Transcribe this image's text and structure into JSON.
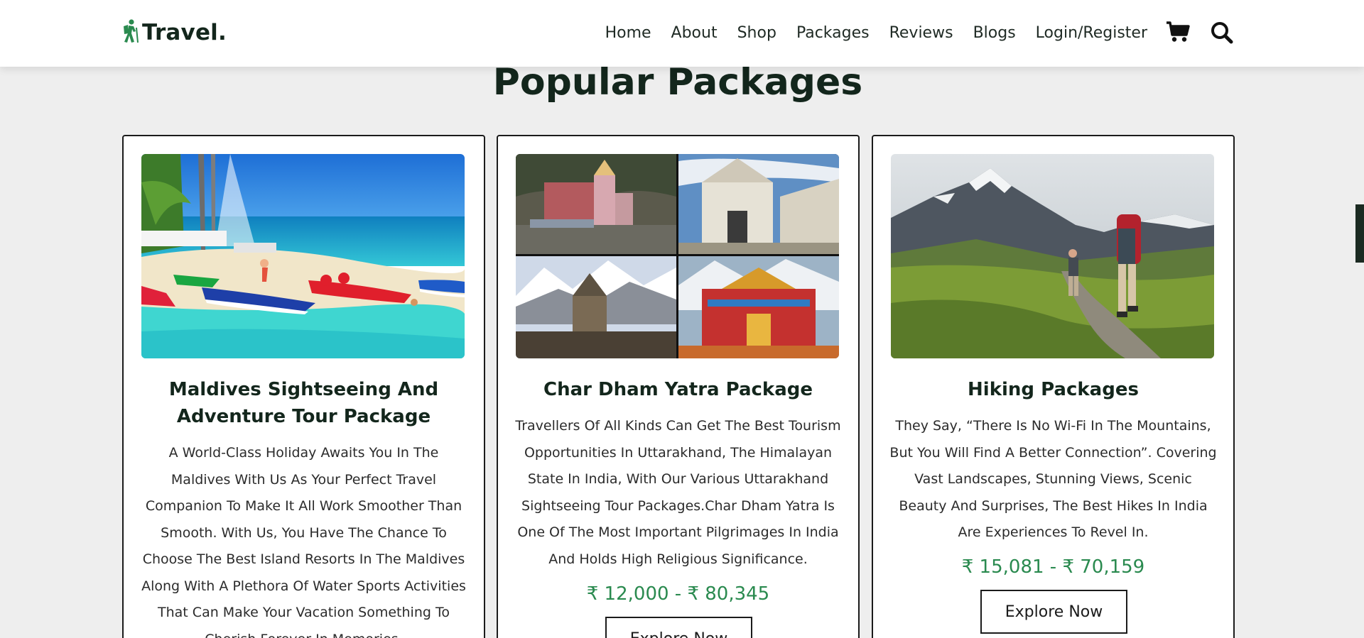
{
  "brand": {
    "name": "Travel",
    "dot": ".",
    "accent": "#2a8a4f"
  },
  "nav": {
    "items": [
      "Home",
      "About",
      "Shop",
      "Packages",
      "Reviews",
      "Blogs",
      "Login/Register"
    ],
    "icons": [
      "cart-icon",
      "search-icon"
    ]
  },
  "section": {
    "title": "Popular Packages"
  },
  "packages": [
    {
      "title": "Maldives Sightseeing And Adventure Tour Package",
      "description": "A World-Class Holiday Awaits You In The Maldives With Us As Your Perfect Travel Companion To Make It All Work Smoother Than Smooth. With Us, You Have The Chance To Choose The Best Island Resorts In The Maldives Along With A Plethora Of Water Sports Activities That Can Make Your Vacation Something To Cherish Forever In Memories.",
      "image": "beach with colorful pedal boats"
    },
    {
      "title": "Char Dham Yatra Package",
      "description": "Travellers Of All Kinds Can Get The Best Tourism Opportunities In Uttarakhand, The Himalayan State In India, With Our Various Uttarakhand Sightseeing Tour Packages.Char Dham Yatra Is One Of The Most Important Pilgrimages In India And Holds High Religious Significance.",
      "price": "₹ 12,000 - ₹ 80,345",
      "button": "Explore Now",
      "image": "four temple collage"
    },
    {
      "title": "Hiking Packages",
      "description": "They Say, “There Is No Wi-Fi In The Mountains, But You Will Find A Better Connection”. Covering Vast Landscapes, Stunning Views, Scenic Beauty And Surprises, The Best Hikes In India Are Experiences To Revel In.",
      "price": "₹ 15,081 - ₹ 70,159",
      "button": "Explore Now",
      "image": "hikers on mountain trail"
    }
  ]
}
